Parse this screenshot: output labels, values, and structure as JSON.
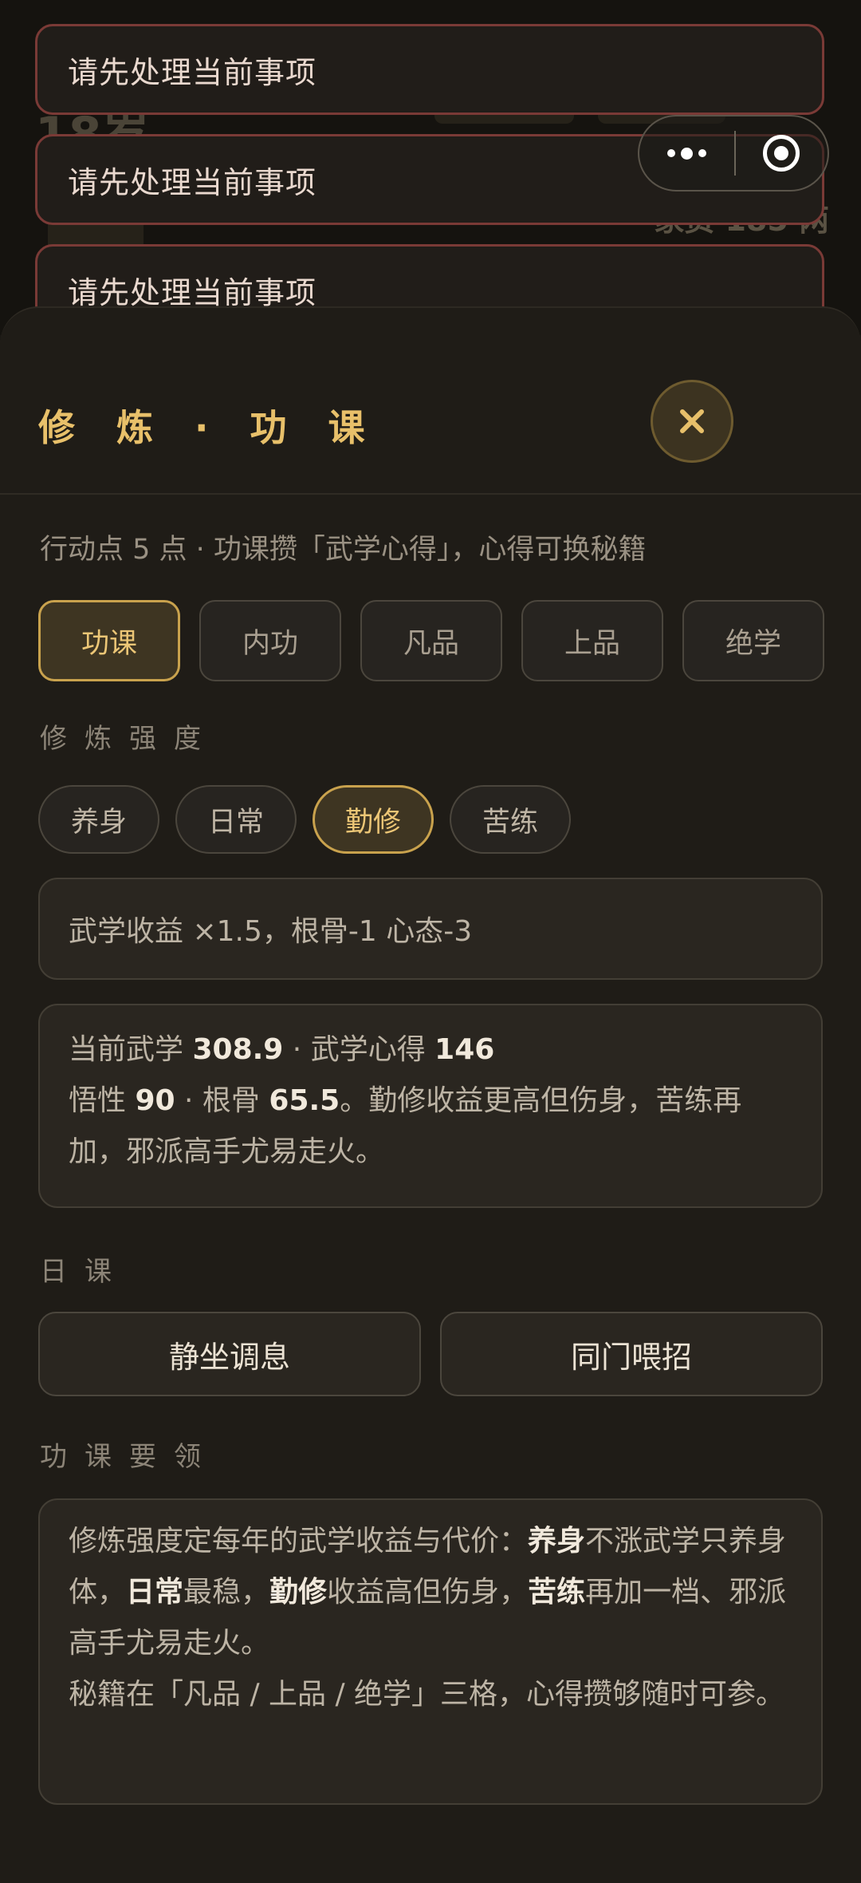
{
  "background": {
    "age": "18岁",
    "money": "家资 185 两"
  },
  "toasts": [
    "请先处理当前事项",
    "请先处理当前事项",
    "请先处理当前事项"
  ],
  "sheet": {
    "title": "修 炼 · 功 课",
    "close_symbol": "×",
    "hint": "行动点 5 点 · 功课攒「武学心得」，心得可换秘籍",
    "tabs": [
      "功课",
      "内功",
      "凡品",
      "上品",
      "绝学"
    ],
    "active_tab": "功课",
    "intensity_label": "修炼强度",
    "intensity_options": [
      "养身",
      "日常",
      "勤修",
      "苦练"
    ],
    "active_intensity": "勤修",
    "effect": "武学收益 ×1.5，根骨-1 心态-3",
    "stats": {
      "wuxue_label": "当前武学",
      "wuxue_value": "308.9",
      "xinde_label": "武学心得",
      "xinde_value": "146",
      "wuxing_label": "悟性",
      "wuxing_value": "90",
      "gengu_label": "根骨",
      "gengu_value": "65.5",
      "note": "。勤修收益更高但伤身，苦练再加，邪派高手尤易走火。"
    },
    "daily_label": "日课",
    "daily_buttons": [
      "静坐调息",
      "同门喂招"
    ],
    "tips_label": "功课要领",
    "tips": {
      "p1": "修炼强度定每年的武学收益与代价：",
      "k1": "养身",
      "p2": "不涨武学只养身体，",
      "k2": "日常",
      "p3": "最稳，",
      "k3": "勤修",
      "p4": "收益高但伤身，",
      "k4": "苦练",
      "p5": "再加一档、邪派高手尤易走火。",
      "line2": "秘籍在「凡品 / 上品 / 绝学」三格，心得攒够随时可参。"
    }
  },
  "colors": {
    "accent": "#e8c06a",
    "toast_border": "#7a3a36",
    "sheet_bg": "#1f1c17"
  }
}
